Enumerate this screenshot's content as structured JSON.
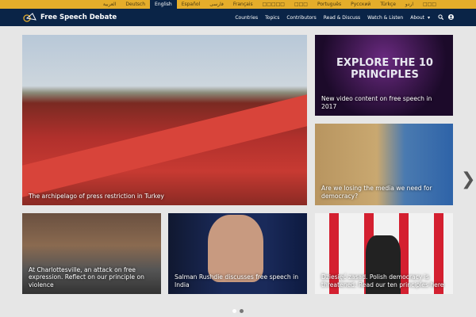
{
  "languages": [
    {
      "label": "العربية"
    },
    {
      "label": "Deutsch"
    },
    {
      "label": "English",
      "active": true
    },
    {
      "label": "Español"
    },
    {
      "label": "فارسی"
    },
    {
      "label": "Français"
    },
    {
      "label": "□□□□□"
    },
    {
      "label": "□□□"
    },
    {
      "label": "Português"
    },
    {
      "label": "Русский"
    },
    {
      "label": "Türkçe"
    },
    {
      "label": "اردو"
    },
    {
      "label": "□□□"
    }
  ],
  "site_title": "Free Speech Debate",
  "menu": [
    "Countries",
    "Topics",
    "Contributors",
    "Read & Discuss",
    "Watch & Listen",
    "About"
  ],
  "cards": [
    {
      "caption": "The archipelago of press restriction in Turkey"
    },
    {
      "caption": "New video content on free speech in 2017",
      "image_text": "EXPLORE THE 10 PRINCIPLES"
    },
    {
      "caption": "Are we losing the media we need for democracy?"
    },
    {
      "caption": "At Charlottesville, an attack on free expression. Reflect on our principle on violence"
    },
    {
      "caption": "Salman Rushdie discusses free speech in India"
    },
    {
      "caption": "Dziesięć zasad. Polish democracy is threatened. Read our ten principles here"
    }
  ],
  "carousel": {
    "pages": 2,
    "active": 2
  }
}
